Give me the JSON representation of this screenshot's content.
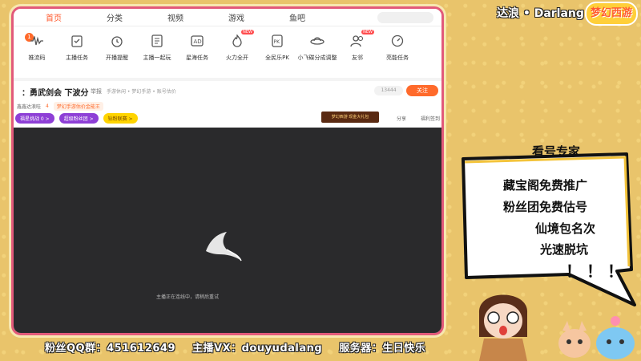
{
  "topnav": {
    "items": [
      "首页",
      "分类",
      "视频",
      "游戏",
      "鱼吧"
    ]
  },
  "icons": [
    {
      "label": "推流码",
      "icon": "waveform-icon"
    },
    {
      "label": "主播任务",
      "icon": "clipboard-icon"
    },
    {
      "label": "开播提醒",
      "icon": "alarm-icon"
    },
    {
      "label": "主播一起玩",
      "icon": "document-icon"
    },
    {
      "label": "星海任务",
      "icon": "ad-icon"
    },
    {
      "label": "火力全开",
      "icon": "fire-icon",
      "badge": "NEW"
    },
    {
      "label": "全民乐PK",
      "icon": "pk-icon"
    },
    {
      "label": "小飞碟分成调整",
      "icon": "ufo-icon"
    },
    {
      "label": "友邻",
      "icon": "people-icon",
      "badge": "NEW"
    },
    {
      "label": "亮能任务",
      "icon": "gauge-icon"
    }
  ],
  "notification_count": "1",
  "room": {
    "title": "：勇武剑会 下波分",
    "report": "举报",
    "categories": "手游休闲 • 梦幻手游 • 账号估价",
    "fans_count": "13444",
    "follow_label": "关注",
    "streamer_name": "鑫鑫达浪哇",
    "heat": "4",
    "tagline": "梦幻手游估价金能王",
    "pill1": "福星挑战 0 >",
    "pill2": "超级粉丝团 >",
    "pill3": "钻粉联赛 >",
    "promo": "梦幻西游 现金大礼包",
    "share": "分享",
    "welfare": "福利签到"
  },
  "player": {
    "message": "主播正在连线中，请稍后重试"
  },
  "overlay": {
    "streamer_title": "达浪 • Darlang",
    "logo_text": "梦幻西游",
    "bubble_title": "看号专家",
    "bubble_lines": [
      "藏宝阁免费推广",
      "粉丝团免费估号",
      "仙境包名次",
      "光速脱坑"
    ],
    "exclaim": "！！！",
    "footer": [
      "粉丝QQ群：451612649",
      "主播VX：douyudalang",
      "服务器：生日快乐"
    ]
  },
  "colors": {
    "accent": "#ff6a2b",
    "frame": "#e25a7a",
    "background": "#e9c46b"
  }
}
